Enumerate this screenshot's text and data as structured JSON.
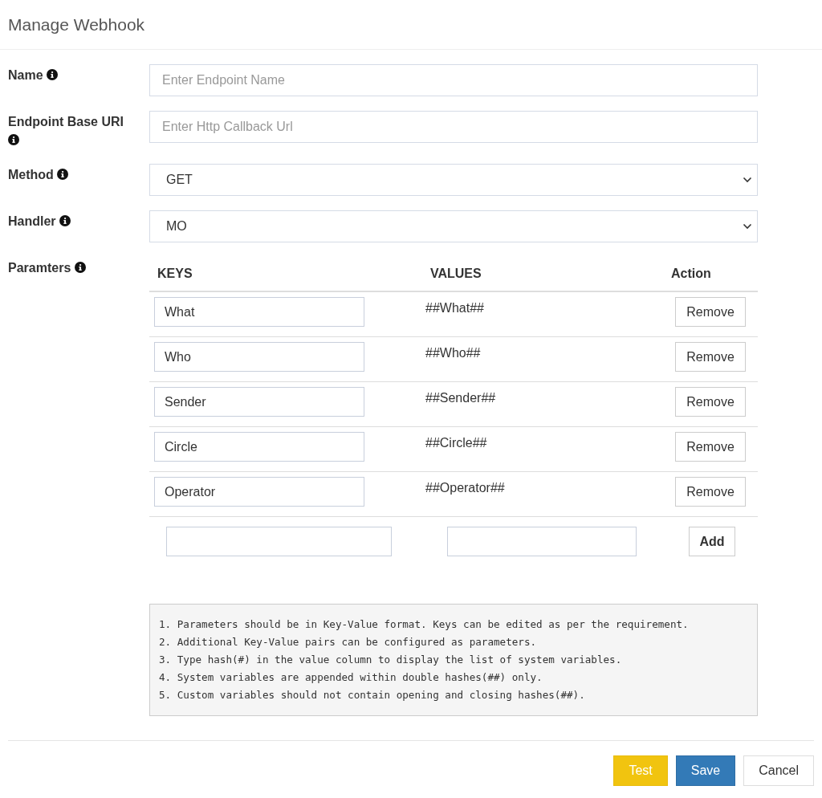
{
  "dialog": {
    "title": "Manage Webhook"
  },
  "fields": [
    {
      "kind": "text",
      "label": "Name",
      "placeholder": "Enter Endpoint Name"
    },
    {
      "kind": "text",
      "label": "Endpoint Base URI",
      "placeholder": "Enter Http Callback Url"
    },
    {
      "kind": "select",
      "label": "Method",
      "value": "GET"
    },
    {
      "kind": "select",
      "label": "Handler",
      "value": "MO"
    }
  ],
  "parameters": {
    "label": "Paramters",
    "columns": [
      "KEYS",
      "VALUES",
      "Action"
    ],
    "rows": [
      {
        "key": "What",
        "value": "##What##",
        "action": "Remove"
      },
      {
        "key": "Who",
        "value": "##Who##",
        "action": "Remove"
      },
      {
        "key": "Sender",
        "value": "##Sender##",
        "action": "Remove"
      },
      {
        "key": "Circle",
        "value": "##Circle##",
        "action": "Remove"
      },
      {
        "key": "Operator",
        "value": "##Operator##",
        "action": "Remove"
      }
    ],
    "add_button": "Add"
  },
  "notes": [
    "1. Parameters should be in Key-Value format. Keys can be edited as per the requirement.",
    "2. Additional Key-Value pairs can be configured as parameters.",
    "3. Type hash(#) in the value column to display the list of system variables.",
    "4. System variables are appended within double hashes(##) only.",
    "5. Custom variables should not contain opening and closing hashes(##)."
  ],
  "footer_buttons": [
    {
      "kind": "warning",
      "label": "Test"
    },
    {
      "kind": "primary",
      "label": "Save"
    },
    {
      "kind": "default",
      "label": "Cancel"
    }
  ]
}
